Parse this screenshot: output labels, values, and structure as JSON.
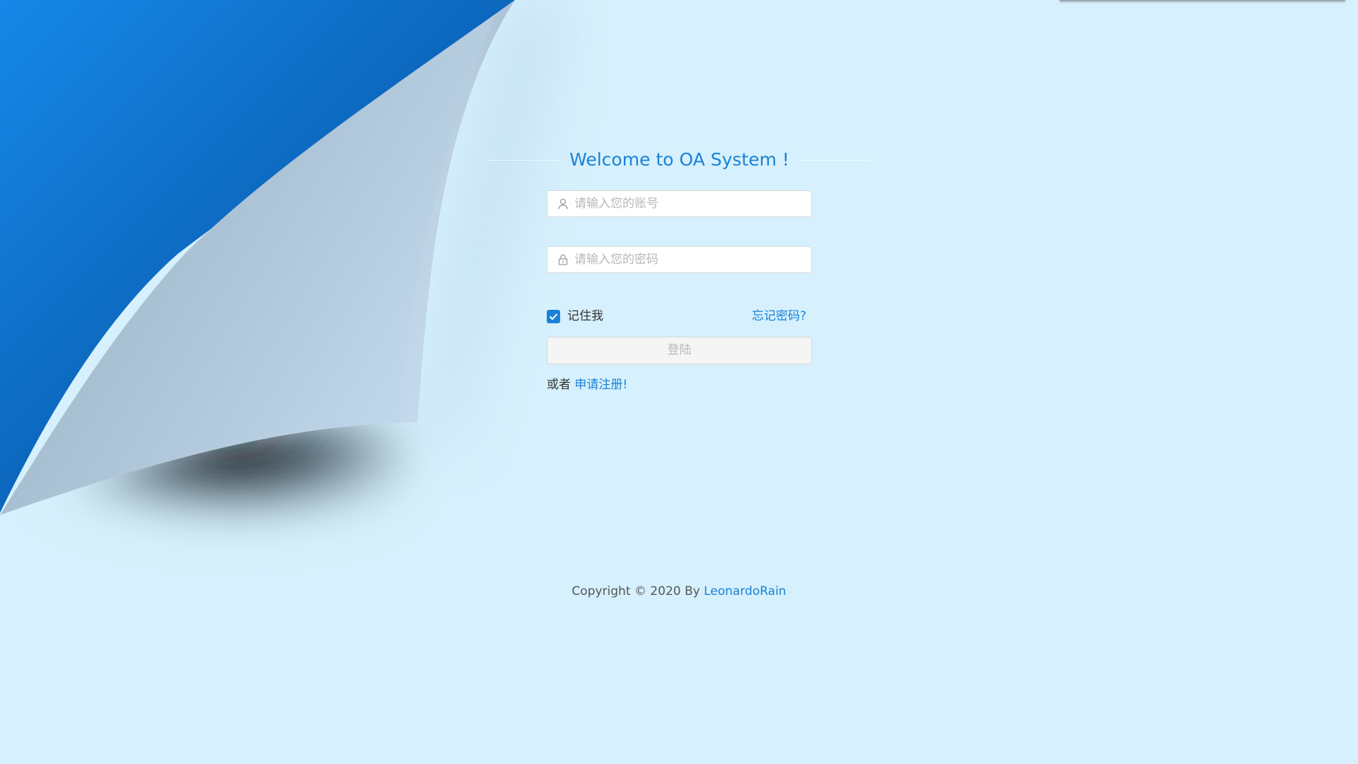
{
  "title": "Welcome to OA System !",
  "form": {
    "username_placeholder": "请输入您的账号",
    "username_value": "",
    "password_placeholder": "请输入您的密码",
    "password_value": "",
    "remember_label": "记住我",
    "remember_checked": true,
    "forgot_label": "忘记密码?",
    "login_label": "登陆"
  },
  "register": {
    "prefix": "或者 ",
    "link": "申请注册",
    "suffix": "!"
  },
  "footer": {
    "prefix": "Copyright ",
    "copyright_symbol": "©",
    "year_text": " 2020 By ",
    "author": "LeonardoRain"
  },
  "colors": {
    "background": "#d6f0fd",
    "accent": "#1a82d6",
    "curl_blue": "#0f6fc9",
    "curl_paper": "#c3d9ee"
  },
  "icons": [
    "user-icon",
    "lock-icon",
    "check-icon"
  ]
}
